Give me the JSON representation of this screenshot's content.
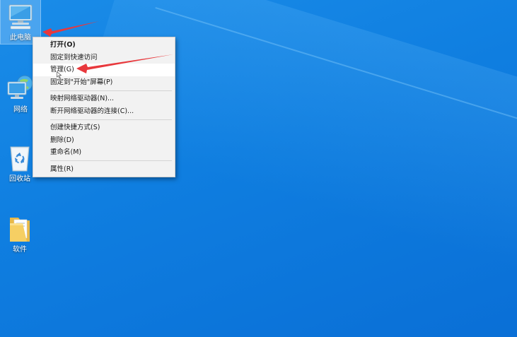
{
  "desktop": {
    "icons": [
      {
        "label": "此电脑",
        "icon": "computer-icon"
      },
      {
        "label": "网络",
        "icon": "network-icon"
      },
      {
        "label": "回收站",
        "icon": "recycle-bin-icon"
      },
      {
        "label": "软件",
        "icon": "folder-icon"
      }
    ]
  },
  "context_menu": {
    "items": [
      {
        "label": "打开(O)",
        "bold": true
      },
      {
        "label": "固定到快速访问"
      },
      {
        "label": "管理(G)",
        "hover": true
      },
      {
        "label": "固定到\"开始\"屏幕(P)"
      },
      {
        "label": "映射网络驱动器(N)..."
      },
      {
        "label": "断开网络驱动器的连接(C)..."
      },
      {
        "label": "创建快捷方式(S)"
      },
      {
        "label": "删除(D)"
      },
      {
        "label": "重命名(M)"
      },
      {
        "label": "属性(R)"
      }
    ]
  },
  "annotations": {
    "arrow_color": "#e8383c"
  },
  "colors": {
    "desktop_bg": "#0f7ee0",
    "menu_bg": "#f2f2f2",
    "menu_hover": "#ffffff"
  }
}
